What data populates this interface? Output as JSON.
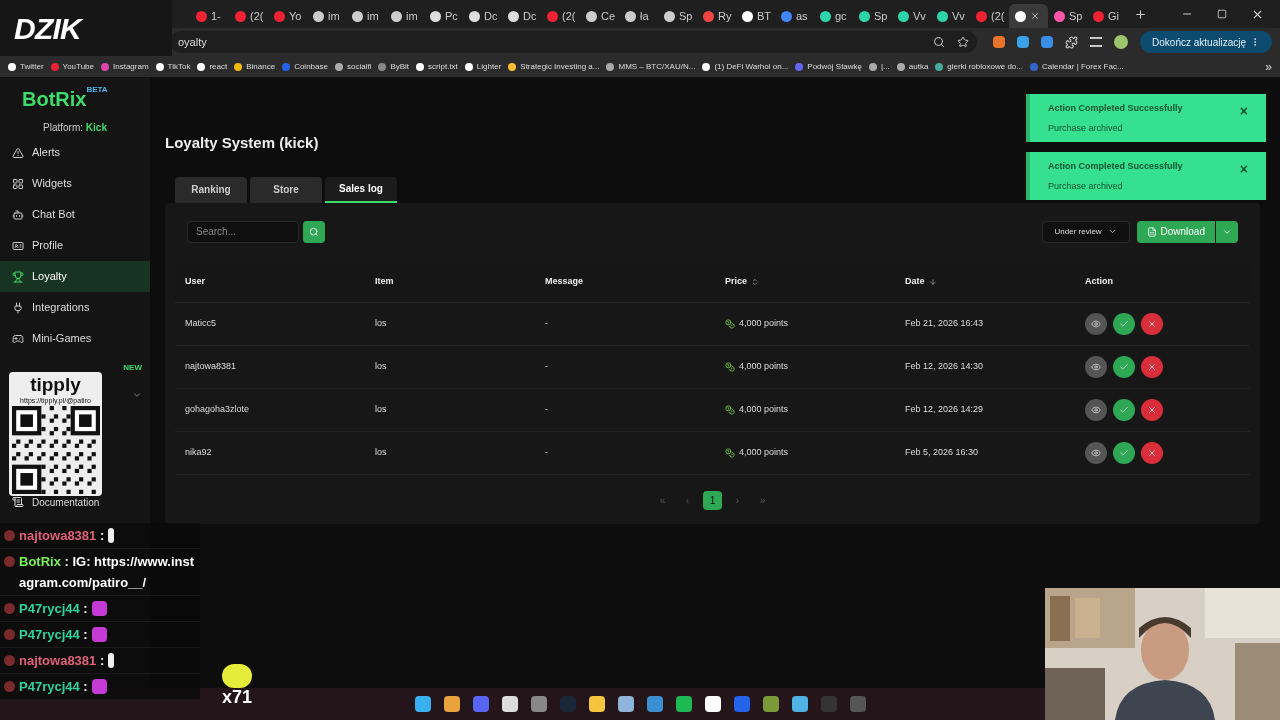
{
  "browser": {
    "tabs": [
      {
        "label": "1-",
        "selected": false
      },
      {
        "label": "(2(",
        "selected": false
      },
      {
        "label": "Yo",
        "selected": false
      },
      {
        "label": "im",
        "selected": false
      },
      {
        "label": "im",
        "selected": false
      },
      {
        "label": "im",
        "selected": false
      },
      {
        "label": "Pc",
        "selected": false
      },
      {
        "label": "Dc",
        "selected": false
      },
      {
        "label": "Dc",
        "selected": false
      },
      {
        "label": "(2(",
        "selected": false
      },
      {
        "label": "Ce",
        "selected": false
      },
      {
        "label": "ła",
        "selected": false
      },
      {
        "label": "Sp",
        "selected": false
      },
      {
        "label": "Ry",
        "selected": false
      },
      {
        "label": "BT",
        "selected": false
      },
      {
        "label": "as",
        "selected": false
      },
      {
        "label": "gc",
        "selected": false
      },
      {
        "label": "Sp",
        "selected": false
      },
      {
        "label": "Vv",
        "selected": false
      },
      {
        "label": "Vv",
        "selected": false
      },
      {
        "label": "(2(",
        "selected": false
      },
      {
        "selected": true
      },
      {
        "label": "Sp",
        "selected": false
      },
      {
        "label": "Gi",
        "selected": false
      }
    ],
    "address": "oyalty",
    "update_button": "Dokończ aktualizację",
    "bookmarks": [
      "Twitter",
      "YouTube",
      "Instagram",
      "TikTok",
      "react",
      "Binance",
      "Coinbase",
      "socialfi",
      "ByBit",
      "script.txt",
      "Lighter",
      "Strategic Investing a...",
      "MMS – BTC/XAU/N...",
      "(1) DeFi Warhol on...",
      "Podwój Stawkę",
      "|...",
      "autka",
      "gierki robloxowe do...",
      "Calendar | Forex Fac..."
    ],
    "more": "»"
  },
  "overlay": {
    "logo": "DZIK",
    "tipply": {
      "name": "tipply",
      "url": "https://tipply.pl/@patiro"
    },
    "chat": [
      {
        "kind": "duck",
        "user": "najtowa8381",
        "color": "#e0607a",
        "text": ":"
      },
      {
        "kind": "plain",
        "user": "BotRix",
        "color": "#7bf05a",
        "text": ": IG: https://www.instagram.com/patiro__/"
      },
      {
        "kind": "blob",
        "user": "P47rycj44",
        "color": "#2ed3a0",
        "text": ":"
      },
      {
        "kind": "blob",
        "user": "P47rycj44",
        "color": "#2ed3a0",
        "text": ":"
      },
      {
        "kind": "duck",
        "user": "najtowa8381",
        "color": "#e0607a",
        "text": ":"
      },
      {
        "kind": "blob",
        "user": "P47rycj44",
        "color": "#2ed3a0",
        "text": ":"
      }
    ],
    "combo": "x71"
  },
  "app": {
    "brand": "BotRix",
    "beta": "BETA",
    "platform_label": "Platform:",
    "platform": "Kick",
    "nav": [
      {
        "label": "Alerts",
        "selected": false
      },
      {
        "label": "Widgets",
        "selected": false
      },
      {
        "label": "Chat Bot",
        "selected": false
      },
      {
        "label": "Profile",
        "selected": false
      },
      {
        "label": "Loyalty",
        "selected": true
      },
      {
        "label": "Integrations",
        "selected": false
      },
      {
        "label": "Mini-Games",
        "selected": false
      }
    ],
    "new_badge": "NEW",
    "documentation": "Documentation",
    "title": "Loyalty System (kick)",
    "tabs": [
      {
        "label": "Ranking",
        "selected": false
      },
      {
        "label": "Store",
        "selected": false
      },
      {
        "label": "Sales log",
        "selected": true
      }
    ],
    "search": {
      "placeholder": "Search..."
    },
    "filter": "Under review",
    "download": "Download",
    "columns": [
      "User",
      "Item",
      "Message",
      "Price",
      "Date",
      "Action"
    ],
    "rows": [
      {
        "user": "Maticc5",
        "item": "los",
        "message": "-",
        "price": "4,000 points",
        "date": "Feb 21, 2026 16:43"
      },
      {
        "user": "najtowa8381",
        "item": "los",
        "message": "-",
        "price": "4,000 points",
        "date": "Feb 12, 2026 14:30"
      },
      {
        "user": "gohagoha3zlote",
        "item": "los",
        "message": "-",
        "price": "4,000 points",
        "date": "Feb 12, 2026 14:29"
      },
      {
        "user": "nika92",
        "item": "los",
        "message": "-",
        "price": "4,000 points",
        "date": "Feb 5, 2026 16:30"
      }
    ],
    "pagination": [
      {
        "label": "«",
        "selected": false
      },
      {
        "label": "‹",
        "selected": false
      },
      {
        "label": "1",
        "selected": true
      },
      {
        "label": "›",
        "selected": false
      },
      {
        "label": "»",
        "selected": false
      }
    ],
    "toasts": [
      {
        "title": "Action Completed Successfully",
        "message": "Purchase archived",
        "close": "×"
      },
      {
        "title": "Action Completed Successfully",
        "message": "Purchase archived",
        "close": "×"
      }
    ]
  }
}
